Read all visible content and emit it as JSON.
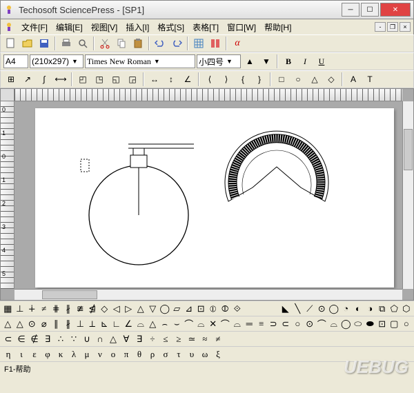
{
  "window": {
    "title": "Techosoft SciencePress - [SP1]"
  },
  "menu": {
    "file": "文件[F]",
    "edit": "编辑[E]",
    "view": "视图[V]",
    "insert": "插入[I]",
    "format": "格式[S]",
    "table": "表格[T]",
    "window": "窗口[W]",
    "help": "帮助[H]"
  },
  "format_bar": {
    "paper": "A4",
    "paper_size": "(210x297)",
    "font": "Times New Roman",
    "size": "小四号"
  },
  "ruler_v": [
    "0",
    "1",
    "0",
    "1",
    "2",
    "3",
    "4",
    "5"
  ],
  "symbols": {
    "row1": [
      "▦",
      "⊥",
      "∔",
      "≠",
      "⋕",
      "∦",
      "≇",
      "⋬",
      "◇",
      "◁",
      "▷",
      "△",
      "▽",
      "◯",
      "▱",
      "⊿",
      "⊡",
      "⦶",
      "⦷",
      "⟐",
      "",
      "",
      "",
      "◣",
      "╲",
      "⟋",
      "⊙",
      "◯",
      "◔",
      "◐",
      "◑",
      "⧉",
      "⬠",
      "⬡"
    ],
    "row2": [
      "△",
      "△",
      "⊙",
      "⌀",
      "∥",
      "∦",
      "⊥",
      "⟂",
      "⊾",
      "∟",
      "∠",
      "⌓",
      "△",
      "⌢",
      "⌣",
      "⌒",
      "⌓",
      "✕",
      "⌒",
      "⌓",
      "═",
      "≡",
      "⊃",
      "⊂",
      "○",
      "⊙",
      "⌒",
      "⌓",
      "◯",
      "⬭",
      "⬬",
      "⊡",
      "▢",
      "○"
    ],
    "row3": [
      "⊂",
      "∈",
      "∉",
      "∃",
      "∴",
      "∵",
      "∪",
      "∩",
      "△",
      "∀",
      "∃",
      "÷",
      "≤",
      "≥",
      "≃",
      "≈",
      "≠"
    ],
    "row4": [
      "η",
      "ι",
      "ε",
      "φ",
      "κ",
      "λ",
      "μ",
      "ν",
      "o",
      "π",
      "θ",
      "ρ",
      "σ",
      "τ",
      "υ",
      "ω",
      "ξ"
    ]
  },
  "status": "F1-帮助",
  "watermark": "UEBUG"
}
